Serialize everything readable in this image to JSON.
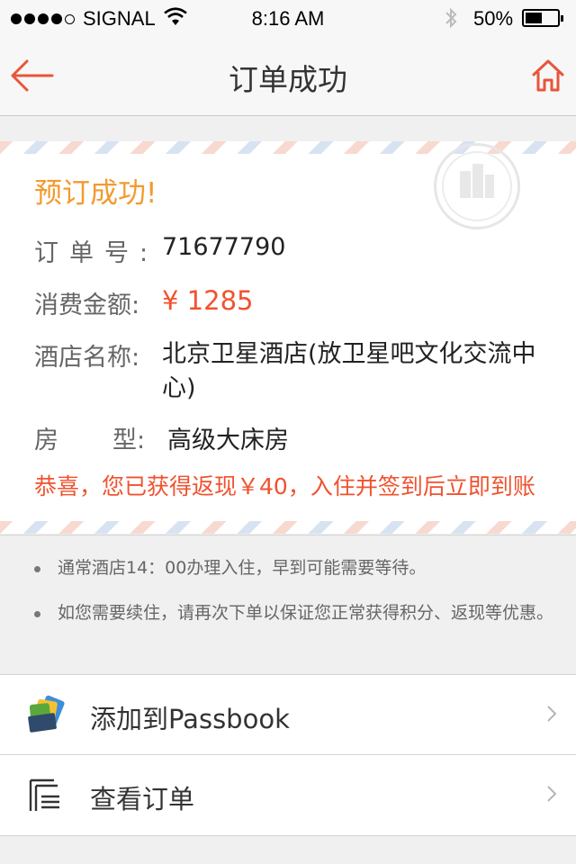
{
  "status_bar": {
    "carrier": "SIGNAL",
    "time": "8:16 AM",
    "battery": "50%"
  },
  "nav": {
    "title": "订单成功",
    "back_icon": "back-arrow-icon",
    "home_icon": "home-icon"
  },
  "order": {
    "success_title": "预订成功!",
    "fields": [
      {
        "label": "订单号:",
        "value": "71677790"
      },
      {
        "label": "消费金额:",
        "value": "¥ 1285"
      },
      {
        "label": "酒店名称:",
        "value": "北京卫星酒店(放卫星吧文化交流中心)"
      },
      {
        "label": "房",
        "label_end": "型:",
        "value": "高级大床房"
      }
    ],
    "cashback": "恭喜，您已获得返现￥40，入住并签到后立即到账"
  },
  "notes": [
    "通常酒店14：00办理入住，早到可能需要等待。",
    "如您需要续住，请再次下单以保证您正常获得积分、返现等优惠。"
  ],
  "menu": [
    {
      "label": "添加到Passbook",
      "icon": "passbook-icon"
    },
    {
      "label": "查看订单",
      "icon": "order-list-icon"
    }
  ],
  "colors": {
    "accent": "#f0522f",
    "success": "#f39a2f",
    "background": "#f0f0f0"
  }
}
